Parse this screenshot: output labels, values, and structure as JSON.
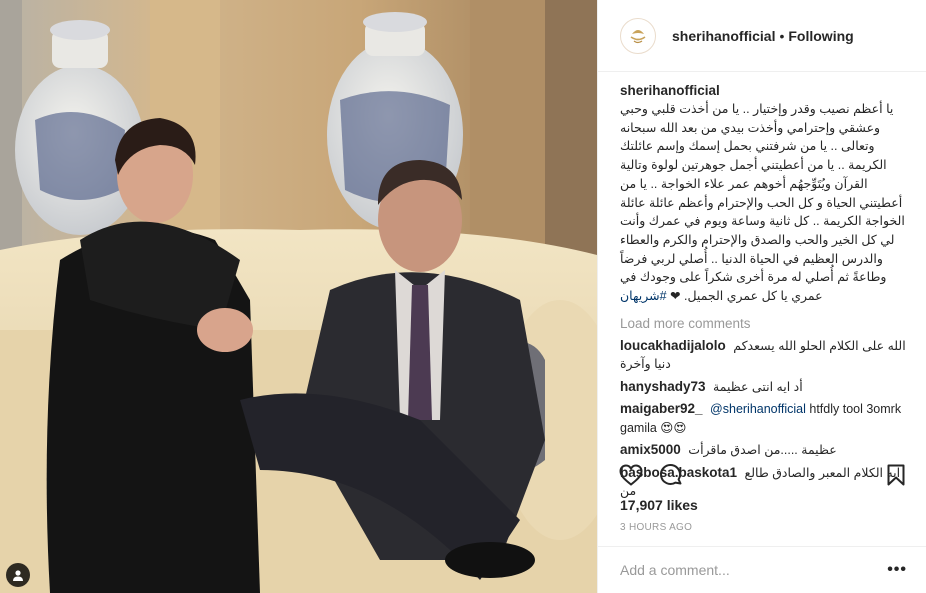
{
  "post": {
    "username": "sherihanofficial",
    "separator": "•",
    "follow_state": "Following",
    "logo_text": "Sherihan"
  },
  "caption": {
    "username": "sherihanofficial",
    "text": "يا أعظم نصيب وقدر وإختيار .. يا من أخذت قلبي وحبي وعشقي وإحترامي وأخذت بيدي من بعد الله سبحانه وتعالى .. يا من شرفتني بحمل إسمك وإسم عائلتك الكريمة .. يا من أعطيتني أجمل جوهرتين لولوة وتالية القرآن ويُتَوِّجهُم أخوهم عمر علاء الخواجة .. يا من أعطيتني الحياة و كل الحب والإحترام وأعظم عائلة عائلة الخواجة الكريمة .. كل ثانية وساعة ويوم في عمرك وأنت لي كل الخير والحب والصدق والإحترام والكرم والعطاء والدرس العظيم في الحياة الدنيا .. أُصلي لربي فرضاً وطاعةً ثم أُصلي له مرة أخرى شكراً على وجودك في عمري يا كل عمري الجميل. ❤",
    "hashtag": "#شريهان"
  },
  "load_more_label": "Load more comments",
  "comments": [
    {
      "user": "loucakhadijalolo",
      "mention": "",
      "text": "الله على الكلام الحلو الله يسعدكم دنيا وآخرة"
    },
    {
      "user": "hanyshady73",
      "mention": "",
      "text": "أد ايه انتى عظيمة"
    },
    {
      "user": "maigaber92_",
      "mention": "@sherihanofficial",
      "text": "htfdly tool 3omrk gamila 😍😍"
    },
    {
      "user": "amix5000",
      "mention": "",
      "text": "عظيمة .....من اصدق ماقرأت"
    },
    {
      "user": "basbosa.baskota1",
      "mention": "",
      "text": "ايه الكلام المعبر والصادق طالع من"
    }
  ],
  "likes": "17,907 likes",
  "timestamp": "3 HOURS AGO",
  "add_comment_placeholder": "Add a comment...",
  "icons": {
    "like": "heart-icon",
    "comment": "speech-bubble-icon",
    "save": "bookmark-icon",
    "more": "ellipsis-icon",
    "tag": "person-tag-icon"
  },
  "colors": {
    "link": "#003569",
    "muted": "#999999",
    "text": "#262626",
    "divider": "#efefef"
  }
}
